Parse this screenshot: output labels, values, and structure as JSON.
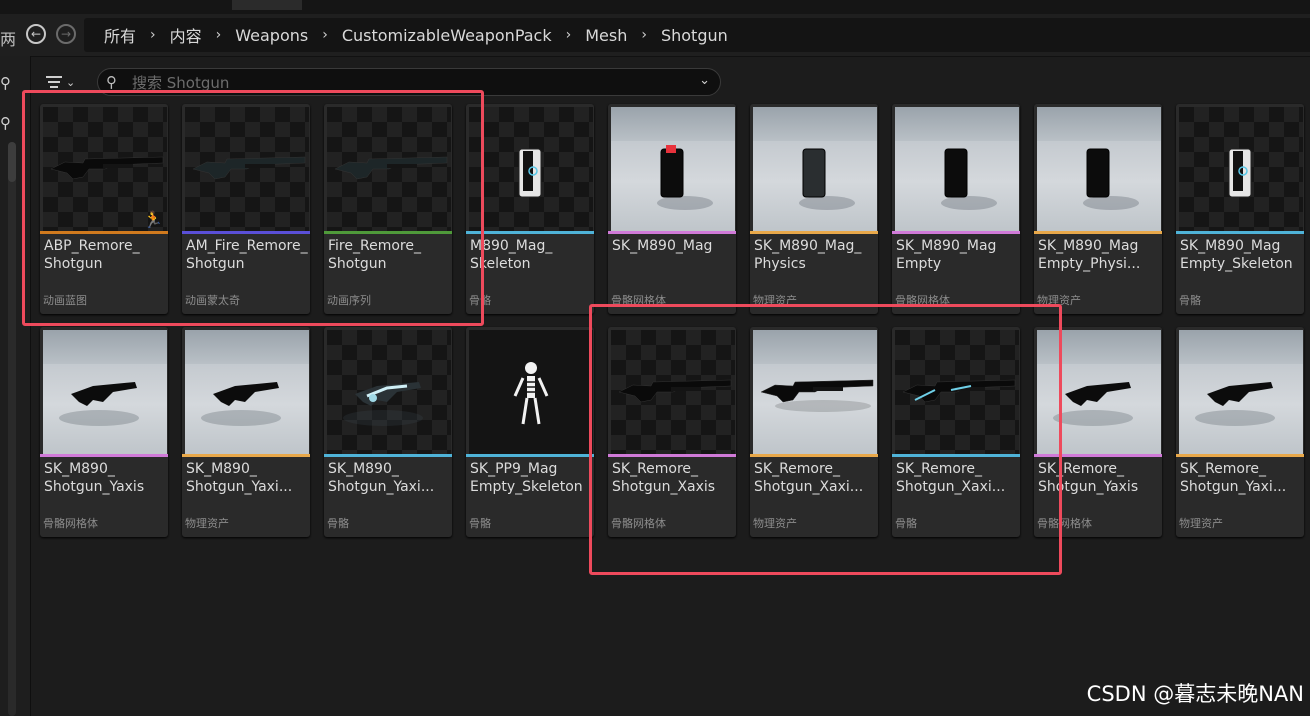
{
  "navigation": {
    "edge_glyph": "两",
    "back_icon": "arrow-left-circle-icon",
    "forward_icon": "arrow-right-circle-icon",
    "breadcrumbs": [
      "所有",
      "内容",
      "Weapons",
      "CustomizableWeaponPack",
      "Mesh",
      "Shotgun"
    ],
    "separator": "›"
  },
  "toolbar": {
    "filter_icon": "filter-icon",
    "search_placeholder": "搜索 Shotgun",
    "search_value": ""
  },
  "sidebar": {
    "icons": [
      "search-icon",
      "search-icon"
    ]
  },
  "assets": [
    {
      "name": "ABP_Remore_\nShotgun",
      "type": "动画蓝图",
      "accent": "#d07a1e",
      "thumb": "checker",
      "object": "shotgun"
    },
    {
      "name": "AM_Fire_Remore_\nShotgun",
      "type": "动画蒙太奇",
      "accent": "#5a4fd8",
      "thumb": "checker",
      "object": "shotgun-dim"
    },
    {
      "name": "Fire_Remore_\nShotgun",
      "type": "动画序列",
      "accent": "#4f9a3a",
      "thumb": "checker",
      "object": "shotgun-dim"
    },
    {
      "name": "M890_Mag_\nSkeleton",
      "type": "骨骼",
      "accent": "#4fb3d8",
      "thumb": "checker",
      "object": "mag-white"
    },
    {
      "name": "SK_M890_Mag",
      "type": "骨骼网格体",
      "accent": "#d07ad8",
      "thumb": "floor",
      "object": "mag-red"
    },
    {
      "name": "SK_M890_Mag_\nPhysics",
      "type": "物理资产",
      "accent": "#e8a84a",
      "thumb": "floor",
      "object": "mag-dark"
    },
    {
      "name": "SK_M890_Mag\nEmpty",
      "type": "骨骼网格体",
      "accent": "#d07ad8",
      "thumb": "floor",
      "object": "mag-black"
    },
    {
      "name": "SK_M890_Mag\nEmpty_Physi...",
      "type": "物理资产",
      "accent": "#e8a84a",
      "thumb": "floor",
      "object": "mag-black"
    },
    {
      "name": "SK_M890_Mag\nEmpty_Skeleton",
      "type": "骨骼",
      "accent": "#4fb3d8",
      "thumb": "checker",
      "object": "mag-white"
    },
    {
      "name": "SK_M890_\nShotgun_Yaxis",
      "type": "骨骼网格体",
      "accent": "#d07ad8",
      "thumb": "floor",
      "object": "gun-y"
    },
    {
      "name": "SK_M890_\nShotgun_Yaxi...",
      "type": "物理资产",
      "accent": "#e8a84a",
      "thumb": "floor",
      "object": "gun-y"
    },
    {
      "name": "SK_M890_\nShotgun_Yaxi...",
      "type": "骨骼",
      "accent": "#4fb3d8",
      "thumb": "checker",
      "object": "gun-y-white"
    },
    {
      "name": "SK_PP9_Mag\nEmpty_Skeleton",
      "type": "骨骼",
      "accent": "#4fb3d8",
      "thumb": "black",
      "object": "skeleton"
    },
    {
      "name": "SK_Remore_\nShotgun_Xaxis",
      "type": "骨骼网格体",
      "accent": "#d07ad8",
      "thumb": "checker",
      "object": "shotgun"
    },
    {
      "name": "SK_Remore_\nShotgun_Xaxi...",
      "type": "物理资产",
      "accent": "#e8a84a",
      "thumb": "floor",
      "object": "shotgun-black"
    },
    {
      "name": "SK_Remore_\nShotgun_Xaxi...",
      "type": "骨骼",
      "accent": "#4fb3d8",
      "thumb": "checker",
      "object": "shotgun-blue"
    },
    {
      "name": "SK_Remore_\nShotgun_Yaxis",
      "type": "骨骼网格体",
      "accent": "#d07ad8",
      "thumb": "floor",
      "object": "gun-y"
    },
    {
      "name": "SK_Remore_\nShotgun_Yaxi...",
      "type": "物理资产",
      "accent": "#e8a84a",
      "thumb": "floor",
      "object": "gun-y"
    }
  ],
  "watermark": "CSDN @暮志未晚NAN",
  "colors": {
    "annotation_box": "#ee4a5c",
    "background": "#1a1a1a",
    "tile": "#2a2a2a"
  }
}
